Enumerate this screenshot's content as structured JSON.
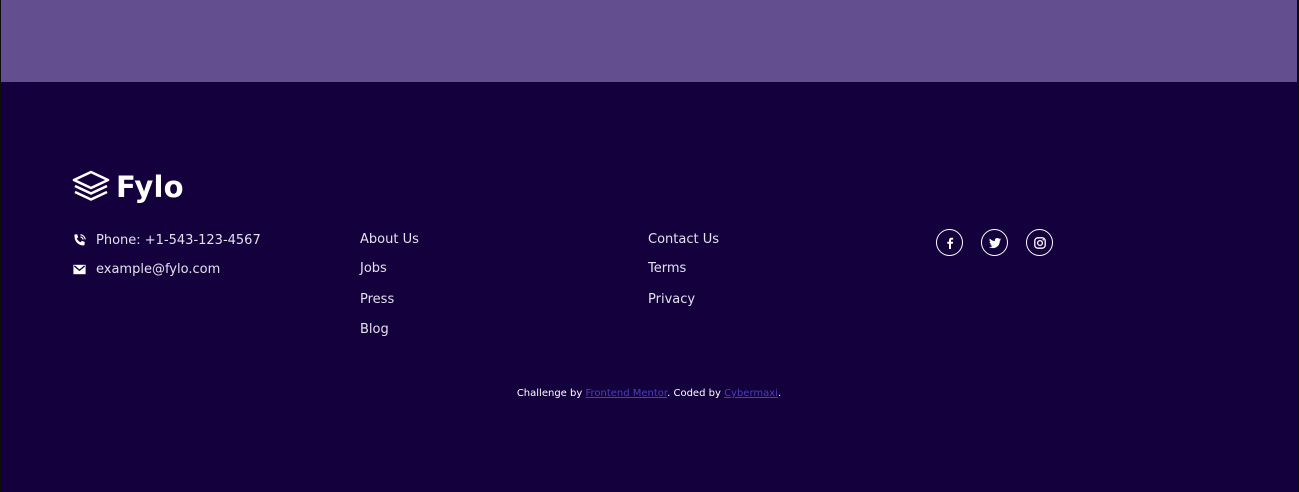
{
  "colors": {
    "top_band": "#634f8f",
    "footer_bg": "#13003d",
    "text": "#e4e0ee",
    "attribution_link": "#4b3fbf"
  },
  "brand": {
    "name": "Fylo",
    "icon": "stacked-layers-icon"
  },
  "contact": {
    "phone": {
      "icon": "phone-icon",
      "text": "Phone: +1-543-123-4567"
    },
    "email": {
      "icon": "mail-icon",
      "text": "example@fylo.com"
    }
  },
  "links_col1": [
    "About Us",
    "Jobs",
    "Press",
    "Blog"
  ],
  "links_col2": [
    "Contact Us",
    "Terms",
    "Privacy"
  ],
  "social": [
    {
      "icon": "facebook-icon"
    },
    {
      "icon": "twitter-icon"
    },
    {
      "icon": "instagram-icon"
    }
  ],
  "attribution": {
    "prefix": "Challenge by ",
    "link1": "Frontend Mentor",
    "middle": ". Coded by ",
    "link2": "Cybermaxi",
    "suffix": "."
  }
}
